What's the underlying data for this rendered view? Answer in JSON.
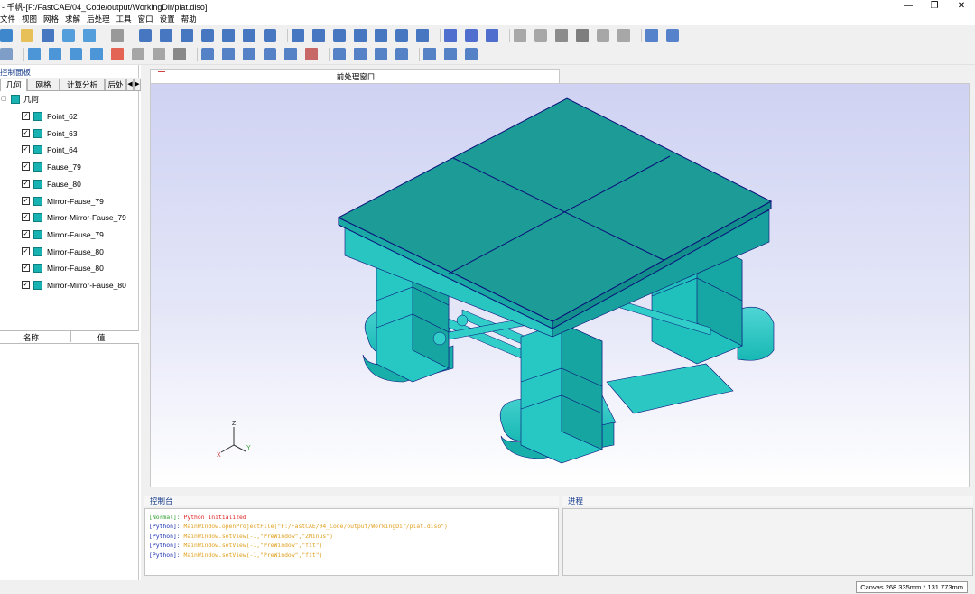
{
  "window": {
    "title": "- 千帆-[F:/FastCAE/04_Code/output/WorkingDir/plat.diso]",
    "min_glyph": "—",
    "max_glyph": "❐",
    "close_glyph": "✕"
  },
  "menu": [
    "文件",
    "视图",
    "网格",
    "求解",
    "后处理",
    "工具",
    "窗口",
    "设置",
    "帮助"
  ],
  "toolbar1": [
    {
      "name": "new-icon",
      "color": "#1e74c6"
    },
    {
      "name": "open-folder-icon",
      "color": "#e5b740"
    },
    {
      "name": "save-icon",
      "color": "#2a62b8"
    },
    {
      "name": "import-geometry-icon",
      "color": "#3a8fd8"
    },
    {
      "name": "export-geometry-icon",
      "color": "#3a8fd8"
    },
    {
      "name": "calculator-icon",
      "color": "#8a8a8a"
    },
    {
      "name": "fit-view-icon",
      "color": "#2a62b8"
    },
    {
      "name": "view-x-plus-icon",
      "color": "#2a62b8"
    },
    {
      "name": "view-x-minus-icon",
      "color": "#2a62b8"
    },
    {
      "name": "view-y-plus-icon",
      "color": "#2a62b8"
    },
    {
      "name": "view-y-minus-icon",
      "color": "#2a62b8"
    },
    {
      "name": "view-z-plus-icon",
      "color": "#2a62b8"
    },
    {
      "name": "view-z-minus-icon",
      "color": "#2a62b8"
    },
    {
      "name": "filter-icon",
      "color": "#2a62b8"
    },
    {
      "name": "select-surface-icon",
      "color": "#2a62b8"
    },
    {
      "name": "select-mesh-icon",
      "color": "#2a62b8"
    },
    {
      "name": "select-box-icon",
      "color": "#2a62b8"
    },
    {
      "name": "select-cell-icon",
      "color": "#2a62b8"
    },
    {
      "name": "select-node-icon",
      "color": "#2a62b8"
    },
    {
      "name": "select-points-icon",
      "color": "#2a62b8"
    },
    {
      "name": "display-solid-icon",
      "color": "#3457c8"
    },
    {
      "name": "display-wire-icon",
      "color": "#3457c8"
    },
    {
      "name": "display-points-icon",
      "color": "#3457c8"
    },
    {
      "name": "box-outline-icon",
      "color": "#9a9a9a"
    },
    {
      "name": "box-wire-icon",
      "color": "#9a9a9a"
    },
    {
      "name": "box-solid-icon",
      "color": "#7a7a7a"
    },
    {
      "name": "box-shaded-icon",
      "color": "#6a6a6a"
    },
    {
      "name": "box-transparent-icon",
      "color": "#9a9a9a"
    },
    {
      "name": "box-edges-icon",
      "color": "#9a9a9a"
    },
    {
      "name": "undo-icon",
      "color": "#3b6fc4"
    },
    {
      "name": "redo-icon",
      "color": "#3b6fc4"
    }
  ],
  "toolbar2": [
    {
      "name": "chart-icon",
      "color": "#6a8fbf"
    },
    {
      "name": "cube-icon",
      "color": "#2f86d4"
    },
    {
      "name": "cylinder-icon",
      "color": "#2f86d4"
    },
    {
      "name": "cone-icon",
      "color": "#2f86d4"
    },
    {
      "name": "sphere-icon",
      "color": "#2f86d4"
    },
    {
      "name": "arrow-icon",
      "color": "#e04a3a"
    },
    {
      "name": "line-icon",
      "color": "#999999"
    },
    {
      "name": "dot-line-icon",
      "color": "#999999"
    },
    {
      "name": "measure-icon",
      "color": "#777777"
    },
    {
      "name": "boolean-union-icon",
      "color": "#3a6fbf"
    },
    {
      "name": "boolean-cut-icon",
      "color": "#3a6fbf"
    },
    {
      "name": "boolean-common-icon",
      "color": "#3a6fbf"
    },
    {
      "name": "copy-icon",
      "color": "#3a6fbf"
    },
    {
      "name": "copy2-icon",
      "color": "#3a6fbf"
    },
    {
      "name": "paste-icon",
      "color": "#c0504d"
    },
    {
      "name": "mirror-icon",
      "color": "#3a6fbf"
    },
    {
      "name": "move-icon",
      "color": "#3a6fbf"
    },
    {
      "name": "rotate-icon",
      "color": "#3a6fbf"
    },
    {
      "name": "scale-icon",
      "color": "#3a6fbf"
    },
    {
      "name": "extrude-icon",
      "color": "#3a6fbf"
    },
    {
      "name": "sweep-icon",
      "color": "#3a6fbf"
    },
    {
      "name": "loft-icon",
      "color": "#3a6fbf"
    }
  ],
  "left_panel": {
    "title": "控制面板",
    "tabs": [
      "几何",
      "网格",
      "计算分析",
      "后处"
    ],
    "tree_root": "几何",
    "tree_items": [
      "Point_62",
      "Point_63",
      "Point_64",
      "Fause_79",
      "Fause_80",
      "Mirror-Fause_79",
      "Mirror-Mirror-Fause_79",
      "Mirror-Fause_79",
      "Mirror-Fause_80",
      "Mirror-Fause_80",
      "Mirror-Mirror-Fause_80"
    ],
    "check_glyph": "✓",
    "props_name": "名称",
    "props_value": "值"
  },
  "viewport": {
    "tab_label": "前处理窗口",
    "axis_z": "Z",
    "axis_y": "Y",
    "axis_x": "X",
    "model_color": "#1fb0a8",
    "model_edge": "#0a0f7a"
  },
  "console": {
    "title": "控制台",
    "lines": [
      {
        "tag": "[Normal]:",
        "msg": "Python Initialized",
        "tag_color": "#2ea02e",
        "msg_color": "#e02020"
      },
      {
        "tag": "[Python]:",
        "msg": "MainWindow.openProjectFile(\"F:/FastCAE/04_Code/output/WorkingDir/plat.diso\")",
        "tag_color": "#1a2fb0",
        "msg_color": "#e0a020"
      },
      {
        "tag": "[Python]:",
        "msg": "MainWindow.setView(-1,\"PreWindow\",\"ZMinus\")",
        "tag_color": "#1a2fb0",
        "msg_color": "#e0a020"
      },
      {
        "tag": "[Python]:",
        "msg": "MainWindow.setView(-1,\"PreWindow\",\"fit\")",
        "tag_color": "#1a2fb0",
        "msg_color": "#e0a020"
      },
      {
        "tag": "[Python]:",
        "msg": "MainWindow.setView(-1,\"PreWindow\",\"fit\")",
        "tag_color": "#1a2fb0",
        "msg_color": "#e0a020"
      }
    ]
  },
  "progress": {
    "title": "进程"
  },
  "status": {
    "canvas": "Canvas 268.335mm * 131.773mm"
  }
}
